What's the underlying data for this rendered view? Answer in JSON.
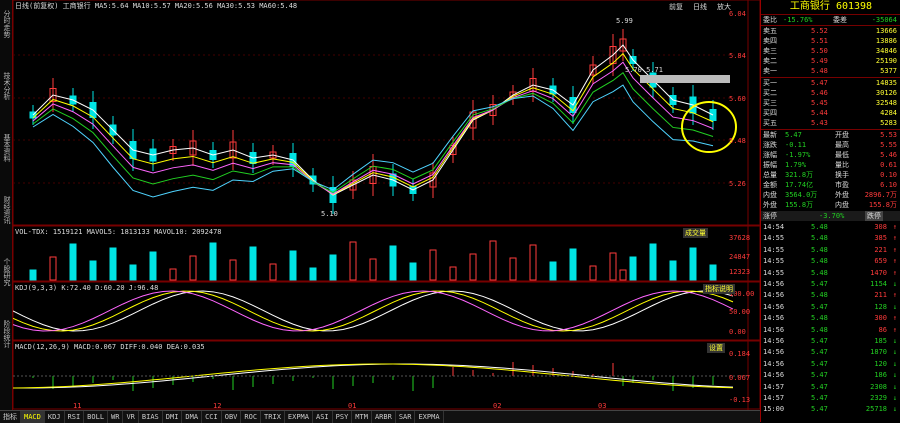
{
  "left_toolbar": [
    "分时走势",
    "技术分析",
    "基本资料",
    "财经资讯",
    "个股研究",
    "阶段统计"
  ],
  "main_chart": {
    "header": "日线(前复权) 工商银行 MA5:5.64 MA10:5.57 MA20:5.56 MA30:5.53 MA60:5.48",
    "price_labels": [
      "6.04",
      "5.84",
      "5.60",
      "5.48",
      "5.26"
    ],
    "high_marker": "5.99",
    "low_marker": "5.10",
    "mid_note": "5.70 5.71",
    "top_right_buttons": [
      "前复",
      "日线",
      "放大"
    ],
    "x_labels": [
      "11",
      "12",
      "01",
      "02",
      "03"
    ]
  },
  "volume_panel": {
    "header": "VOL-TDX: 1519121 MAVOL5: 1813133 MAVOL10: 2092478",
    "axis_labels": [
      "37628",
      "24847",
      "12323"
    ],
    "badge": "成交量"
  },
  "kdj_panel": {
    "header": "KDJ(9,3,3) K:72.40 D:60.20 J:96.48",
    "axis_labels": [
      "100.00",
      "50.00",
      "0.00"
    ],
    "badge": "指标说明"
  },
  "macd_panel": {
    "header": "MACD(12,26,9) MACD:0.067 DIFF:0.040 DEA:0.035",
    "axis_labels": [
      "0.184",
      "0.067",
      "-0.13"
    ],
    "badge": "设置"
  },
  "bottom_tabs": [
    "指标",
    "MACD",
    "KDJ",
    "RSI",
    "BOLL",
    "WR",
    "VR",
    "BIAS",
    "DMI",
    "DMA",
    "CCI",
    "OBV",
    "ROC",
    "TRIX",
    "EXPMA",
    "ASI",
    "PSY",
    "MTM",
    "ARBR",
    "SAR",
    "EXPMA"
  ],
  "right_panel": {
    "title": "工商银行 601398",
    "ratio": {
      "label": "委比",
      "value": "-15.76%",
      "label2": "委差",
      "value2": "-35064"
    },
    "sell": [
      {
        "label": "卖五",
        "price": "5.52",
        "vol": "13666"
      },
      {
        "label": "卖四",
        "price": "5.51",
        "vol": "13886"
      },
      {
        "label": "卖三",
        "price": "5.50",
        "vol": "34846"
      },
      {
        "label": "卖二",
        "price": "5.49",
        "vol": "25190"
      },
      {
        "label": "卖一",
        "price": "5.48",
        "vol": "5377"
      }
    ],
    "buy": [
      {
        "label": "买一",
        "price": "5.47",
        "vol": "14835"
      },
      {
        "label": "买二",
        "price": "5.46",
        "vol": "30126"
      },
      {
        "label": "买三",
        "price": "5.45",
        "vol": "32548"
      },
      {
        "label": "买四",
        "price": "5.44",
        "vol": "4284"
      },
      {
        "label": "买五",
        "price": "5.43",
        "vol": "5283"
      }
    ],
    "quote": [
      [
        "最新",
        "5.47",
        "开盘",
        "5.53"
      ],
      [
        "涨跌",
        "-0.11",
        "最高",
        "5.55"
      ],
      [
        "涨幅",
        "-1.97%",
        "最低",
        "5.46"
      ],
      [
        "振幅",
        "1.79%",
        "量比",
        "0.61"
      ],
      [
        "总量",
        "321.8万",
        "换手",
        "0.10"
      ],
      [
        "金额",
        "17.74亿",
        "市盈",
        "6.10"
      ],
      [
        "内盘",
        "3564.0万",
        "外盘",
        "2896.7万"
      ],
      [
        "外盘",
        "155.8万",
        "内盘",
        "155.8万"
      ]
    ],
    "ticks_header": {
      "left": "涨停",
      "mid": "-3.70%",
      "right": "跌停"
    },
    "ticks": [
      [
        "14:54",
        "5.48",
        "308",
        "red"
      ],
      [
        "14:55",
        "5.48",
        "385",
        "red"
      ],
      [
        "14:55",
        "5.48",
        "221",
        "red"
      ],
      [
        "14:55",
        "5.48",
        "659",
        "red"
      ],
      [
        "14:55",
        "5.48",
        "1470",
        "red"
      ],
      [
        "14:56",
        "5.47",
        "1154",
        "grn"
      ],
      [
        "14:56",
        "5.48",
        "211",
        "red"
      ],
      [
        "14:56",
        "5.47",
        "128",
        "grn"
      ],
      [
        "14:56",
        "5.48",
        "300",
        "red"
      ],
      [
        "14:56",
        "5.48",
        "86",
        "red"
      ],
      [
        "14:56",
        "5.47",
        "185",
        "grn"
      ],
      [
        "14:56",
        "5.47",
        "1870",
        "grn"
      ],
      [
        "14:56",
        "5.47",
        "120",
        "grn"
      ],
      [
        "14:56",
        "5.47",
        "186",
        "grn"
      ],
      [
        "14:57",
        "5.47",
        "2308",
        "grn"
      ],
      [
        "14:57",
        "5.47",
        "2329",
        "grn"
      ],
      [
        "15:00",
        "5.47",
        "25718",
        "grn"
      ]
    ]
  }
}
